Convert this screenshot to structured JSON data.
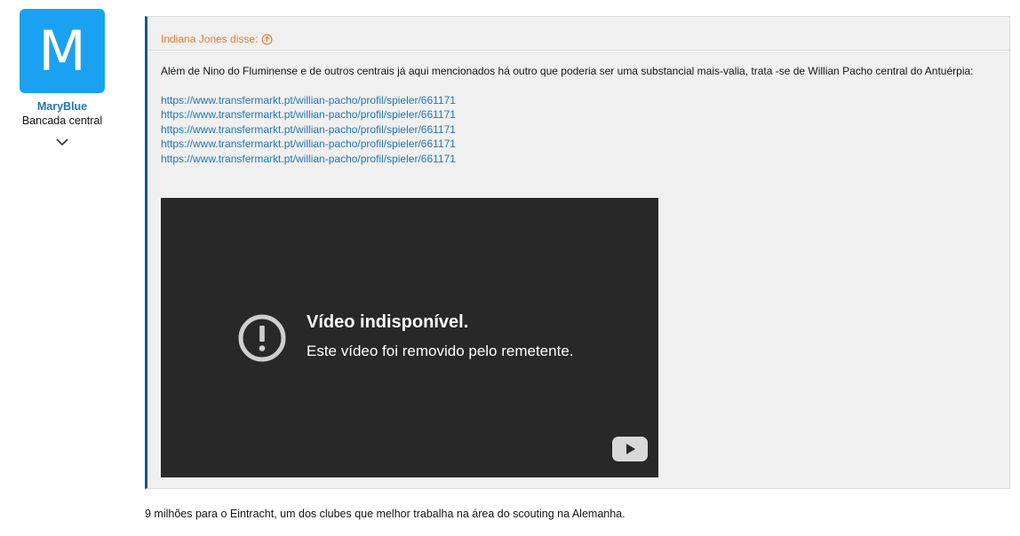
{
  "user": {
    "avatar_letter": "M",
    "avatar_color": "#1ba1f2",
    "name": "MaryBlue",
    "name_color": "#2577b1",
    "title": "Bancada central",
    "toggle_icon": "chevron-down-icon"
  },
  "quote": {
    "author_label": "Indiana Jones disse:",
    "author_color": "#e87a2e",
    "link_icon": "arrow-up-circle-icon",
    "text": "Além de Nino do Fluminense e de outros centrais já aqui mencionados há outro que poderia ser uma substancial mais-valia, trata -se de Willian Pacho central do Antuérpia:",
    "link_color": "#2577b1",
    "links": [
      "https://www.transfermarkt.pt/willian-pacho/profil/spieler/661171",
      "https://www.transfermarkt.pt/willian-pacho/profil/spieler/661171",
      "https://www.transfermarkt.pt/willian-pacho/profil/spieler/661171",
      "https://www.transfermarkt.pt/willian-pacho/profil/spieler/661171",
      "https://www.transfermarkt.pt/willian-pacho/profil/spieler/661171"
    ],
    "video": {
      "title": "Vídeo indisponível.",
      "subtitle": "Este vídeo foi removido pelo remetente.",
      "warning_icon": "exclamation-circle-icon",
      "logo_icon": "youtube-logo-icon"
    }
  },
  "post": {
    "text": "9 milhões para o Eintracht, um dos clubes que melhor trabalha na área do scouting na Alemanha."
  }
}
